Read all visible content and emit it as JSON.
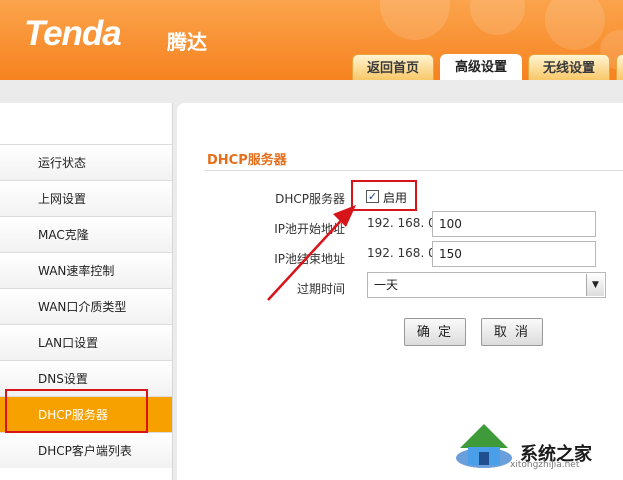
{
  "brand": {
    "logo_text": "Tenda",
    "logo_cn": "腾达"
  },
  "tabs": [
    {
      "label": "返回首页"
    },
    {
      "label": "高级设置",
      "active": true
    },
    {
      "label": "无线设置"
    }
  ],
  "sidebar": {
    "items": [
      {
        "label": "运行状态"
      },
      {
        "label": "上网设置"
      },
      {
        "label": "MAC克隆"
      },
      {
        "label": "WAN速率控制"
      },
      {
        "label": "WAN口介质类型"
      },
      {
        "label": "LAN口设置"
      },
      {
        "label": "DNS设置"
      },
      {
        "label": "DHCP服务器",
        "active": true
      },
      {
        "label": "DHCP客户端列表"
      }
    ]
  },
  "form": {
    "section_title": "DHCP服务器",
    "dhcp_label": "DHCP服务器",
    "enable_label": "启用",
    "enable_checked": true,
    "start_label": "IP池开始地址",
    "start_prefix": "192. 168. 0.",
    "start_value": "100",
    "end_label": "IP池结束地址",
    "end_prefix": "192. 168. 0.",
    "end_value": "150",
    "lease_label": "过期时间",
    "lease_value": "一天",
    "confirm_label": "确 定",
    "cancel_label": "取 消"
  },
  "watermark": {
    "text": "系统之家",
    "url": "xitongzhijia.net"
  },
  "colors": {
    "header": "#f6821f",
    "active_nav": "#f7a100",
    "section_title": "#e56f1b",
    "annotation": "#d8141b"
  }
}
